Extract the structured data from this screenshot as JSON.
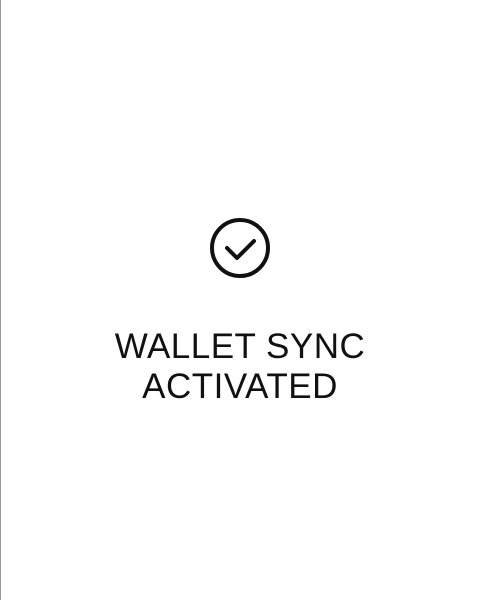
{
  "screen": {
    "background_color": "#ffffff",
    "text_color": "#111111",
    "border_color": "#9a9a9a"
  },
  "status": {
    "icon": "check-circle-icon",
    "title_line_1": "WALLET SYNC",
    "title_line_2": "ACTIVATED"
  }
}
